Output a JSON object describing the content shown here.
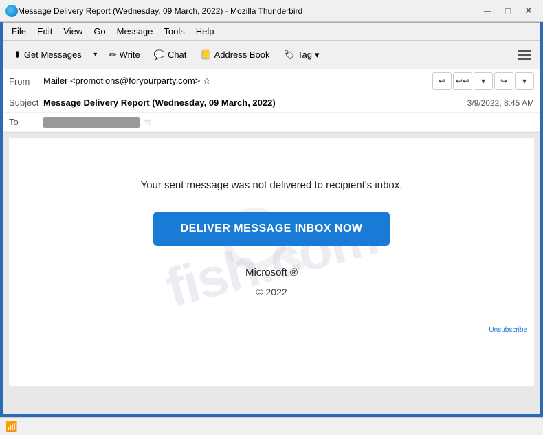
{
  "titleBar": {
    "title": "Message Delivery Report (Wednesday, 09 March, 2022) - Mozilla Thunderbird",
    "minBtn": "─",
    "maxBtn": "□",
    "closeBtn": "✕"
  },
  "menuBar": {
    "items": [
      {
        "label": "File",
        "underline": true
      },
      {
        "label": "Edit",
        "underline": true
      },
      {
        "label": "View",
        "underline": true
      },
      {
        "label": "Go",
        "underline": true
      },
      {
        "label": "Message",
        "underline": true
      },
      {
        "label": "Tools",
        "underline": true
      },
      {
        "label": "Help",
        "underline": true
      }
    ]
  },
  "toolbar": {
    "getMessages": "Get Messages",
    "write": "Write",
    "chat": "Chat",
    "addressBook": "Address Book",
    "tag": "Tag"
  },
  "emailHeader": {
    "fromLabel": "From",
    "fromValue": "Mailer <promotions@foryourparty.com> ☆",
    "subjectLabel": "Subject",
    "subjectValue": "Message Delivery Report (Wednesday, 09 March, 2022)",
    "dateValue": "3/9/2022, 8:45 AM",
    "toLabel": "To"
  },
  "emailBody": {
    "watermarkText": "fish.com",
    "mainMessage": "Your sent message was not delivered to recipient's inbox.",
    "deliverButtonText": "DELIVER MESSAGE INBOX NOW",
    "brandName": "Microsoft ®",
    "copyright": "© 2022",
    "unsubscribeText": "Unsubscribe"
  },
  "bottomBar": {
    "wifiIcon": "📶"
  }
}
